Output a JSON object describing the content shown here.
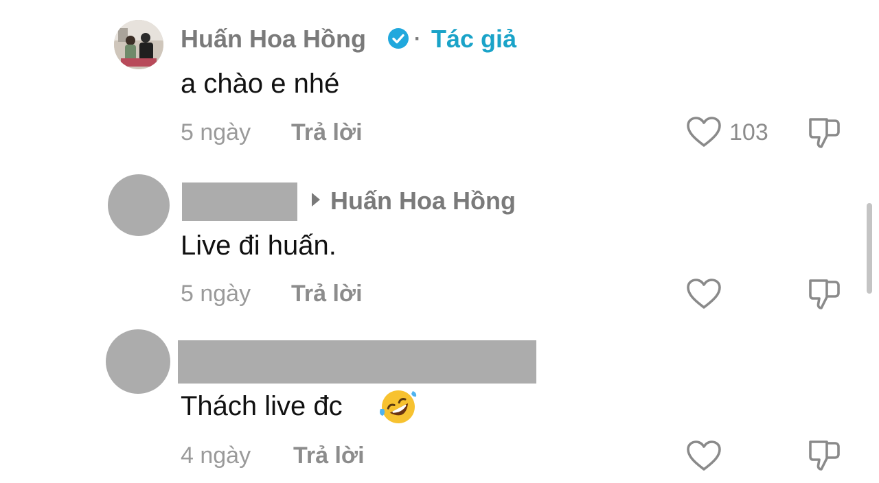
{
  "comments": [
    {
      "username": "Huấn Hoa Hồng",
      "separator": "·",
      "author_tag": "Tác giả",
      "text": "a chào e nhé",
      "time": "5 ngày",
      "reply_label": "Trả lời",
      "like_count": "103"
    },
    {
      "reply_to": "Huấn Hoa Hồng",
      "text": "Live đi huấn.",
      "time": "5 ngày",
      "reply_label": "Trả lời"
    },
    {
      "text": "Thách live đc",
      "emoji": "🤣",
      "time": "4 ngày",
      "reply_label": "Trả lời"
    }
  ],
  "colors": {
    "verified": "#20a8dd",
    "author_tag": "#1aa3c8",
    "redaction": "#acacac"
  },
  "icons": [
    "verified-badge-icon",
    "play-arrow-icon",
    "heart-icon",
    "dislike-icon"
  ]
}
